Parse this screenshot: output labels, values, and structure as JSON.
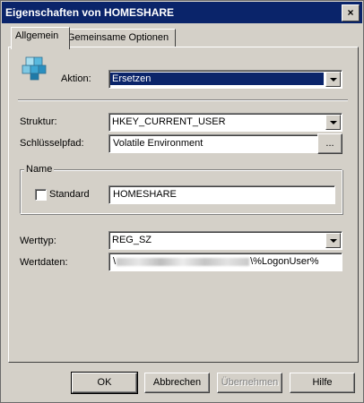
{
  "window": {
    "title": "Eigenschaften von HOMESHARE",
    "close_glyph": "×"
  },
  "tabs": [
    {
      "label": "Allgemein",
      "active": true
    },
    {
      "label": "Gemeinsame Optionen",
      "active": false
    }
  ],
  "form": {
    "icon": "registry-cubes-icon",
    "aktion": {
      "label": "Aktion:",
      "value": "Ersetzen"
    },
    "struktur": {
      "label": "Struktur:",
      "value": "HKEY_CURRENT_USER"
    },
    "schluesselpfad": {
      "label": "Schlüsselpfad:",
      "value": "Volatile Environment",
      "browse": "..."
    },
    "name_group": {
      "legend": "Name",
      "standard_label": "Standard",
      "standard_checked": false,
      "value": "HOMESHARE"
    },
    "werttyp": {
      "label": "Werttyp:",
      "value": "REG_SZ"
    },
    "wertdaten": {
      "label": "Wertdaten:",
      "prefix": "\\",
      "suffix": "\\%LogonUser%"
    }
  },
  "buttons": {
    "ok": "OK",
    "cancel": "Abbrechen",
    "apply": "Übernehmen",
    "help": "Hilfe"
  },
  "colors": {
    "selection": "#0a246a",
    "dialog": "#d4d0c8"
  }
}
